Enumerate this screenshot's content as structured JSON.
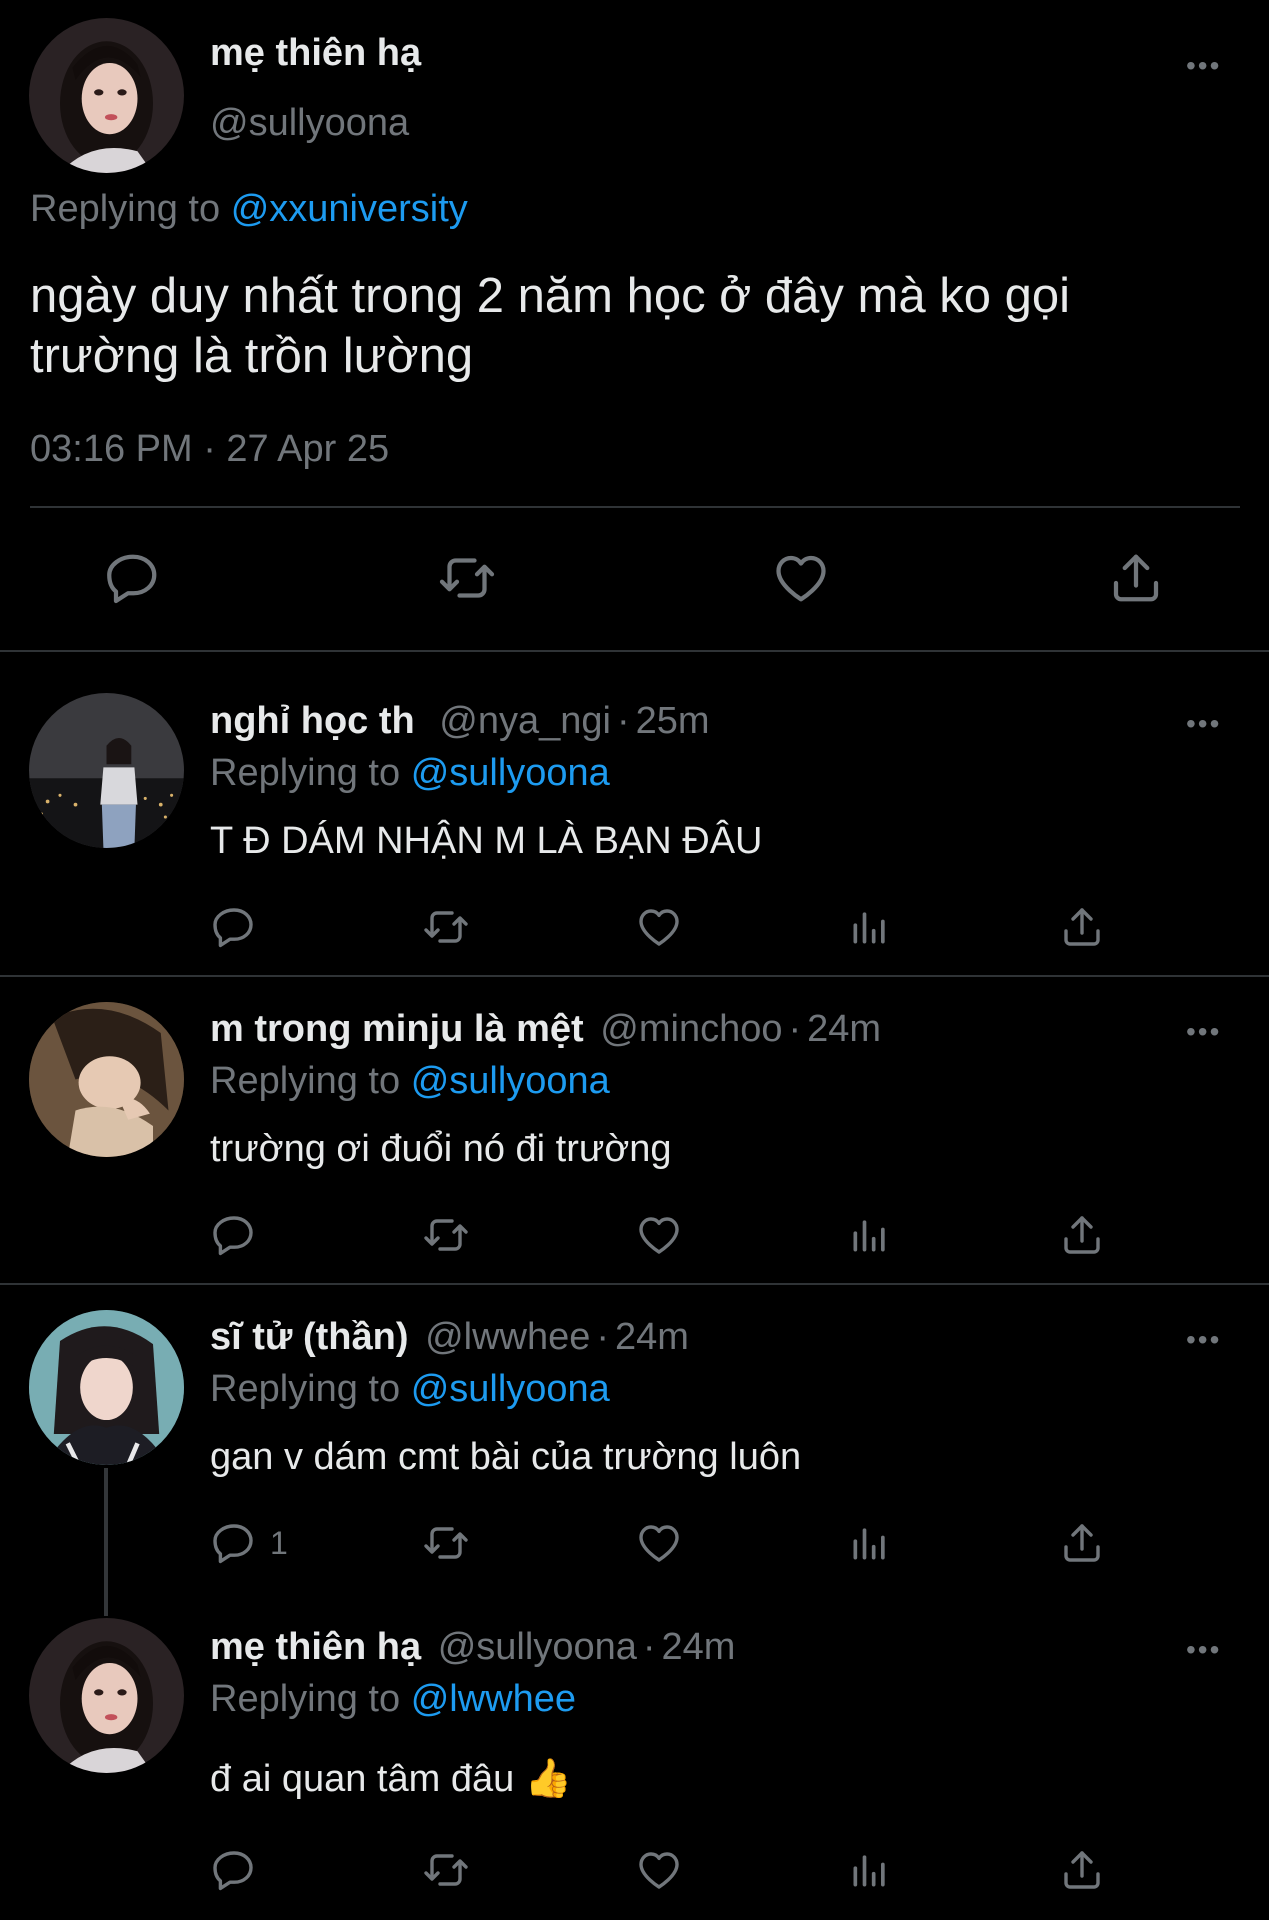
{
  "main_tweet": {
    "display_name": "mẹ thiên hạ",
    "handle": "@sullyoona",
    "replying_prefix": "Replying to",
    "replying_handle": "@xxuniversity",
    "text_line1": "ngày duy nhất trong 2 năm học ở đây mà ko gọi",
    "text_line2": "trường là trồn lường",
    "timestamp": "03:16 PM · 27 Apr 25",
    "more": "•••",
    "actions": [
      "reply-icon",
      "retweet-icon",
      "like-icon",
      "share-icon"
    ]
  },
  "replies": [
    {
      "display_name": "nghỉ học th",
      "handle": "@nya_ngi",
      "time": "25m",
      "replying_prefix": "Replying to",
      "replying_handle": "@sullyoona",
      "text": "T Đ DÁM NHẬN M LÀ BẠN ĐÂU",
      "reply_count": "",
      "more": "•••"
    },
    {
      "display_name": "m trong minju là mệt",
      "handle": "@minchoo",
      "time": "24m",
      "replying_prefix": "Replying to",
      "replying_handle": "@sullyoona",
      "text": "trường ơi đuổi nó đi trường",
      "reply_count": "",
      "more": "•••"
    },
    {
      "display_name": "sĩ tử (thần)",
      "handle": "@lwwhee",
      "time": "24m",
      "replying_prefix": "Replying to",
      "replying_handle": "@sullyoona",
      "text": "gan v dám cmt bài của trường luôn",
      "reply_count": "1",
      "more": "•••"
    },
    {
      "display_name": "mẹ thiên hạ",
      "handle": "@sullyoona",
      "time": "24m",
      "replying_prefix": "Replying to",
      "replying_handle": "@lwwhee",
      "text": "đ ai quan tâm đâu 👍",
      "reply_count": "",
      "more": "•••"
    }
  ],
  "colors": {
    "background": "#000000",
    "text": "#e7e9ea",
    "muted": "#71767b",
    "link": "#1d9bf0",
    "divider": "#2f3336"
  }
}
